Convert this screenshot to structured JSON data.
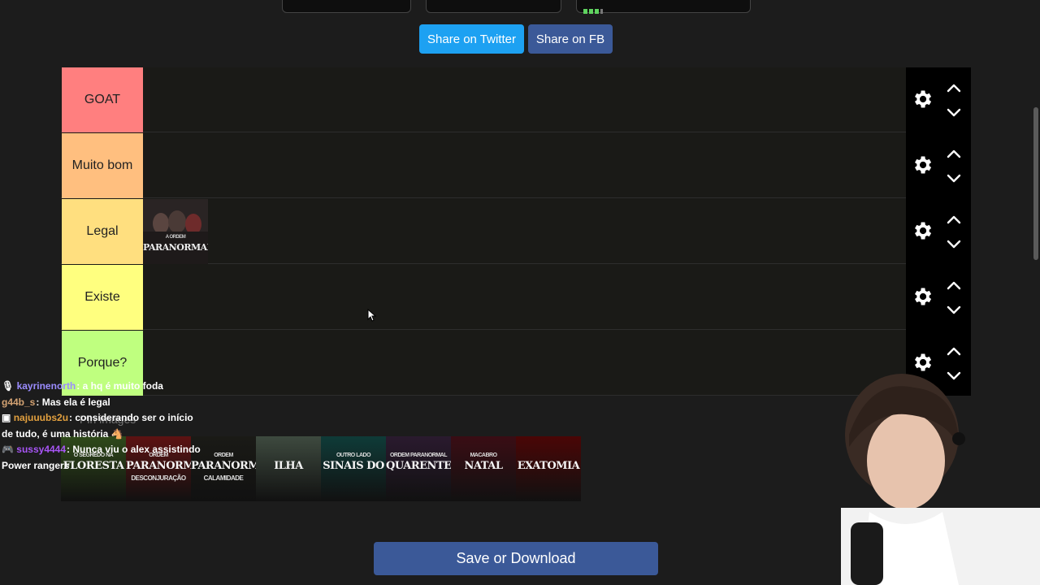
{
  "share": {
    "twitter_label": "Share on Twitter",
    "fb_label": "Share on FB",
    "twitter_color": "#1da1f2",
    "fb_color": "#3b5998"
  },
  "tiers": [
    {
      "label": "GOAT",
      "color": "#ff7f7f"
    },
    {
      "label": "Muito bom",
      "color": "#ffbf7f"
    },
    {
      "label": "Legal",
      "color": "#ffdf7f"
    },
    {
      "label": "Existe",
      "color": "#ffff7f"
    },
    {
      "label": "Porque?",
      "color": "#bfff7f"
    }
  ],
  "tier_items": {
    "legal": [
      {
        "name": "A Ordem Paranormal",
        "title": "PARANORMAL",
        "subtitle": "A ORDEM"
      }
    ]
  },
  "controls": {
    "settings_icon": "gear-icon",
    "up_icon": "chevron-up-icon",
    "down_icon": "chevron-down-icon"
  },
  "pool": {
    "label": "Pin images",
    "items": [
      {
        "title": "FLORESTA",
        "subtitle": "O SEGREDO NA",
        "color": "#2f4a1a"
      },
      {
        "title": "PARANORMAL",
        "subtitle": "ORDEM",
        "extra": "DESCONJURAÇÃO",
        "color": "#5c1212"
      },
      {
        "title": "PARANORMAL",
        "subtitle": "ORDEM",
        "extra": "CALAMIDADE",
        "color": "#1a1a16"
      },
      {
        "title": "ILHA",
        "subtitle": "",
        "color": "#3e4a3f"
      },
      {
        "title": "SINAIS DO",
        "subtitle": "OUTRO LADO",
        "color": "#0f3b38"
      },
      {
        "title": "QUARENTENA",
        "subtitle": "ORDEM PARANORMAL",
        "color": "#2a1a2e"
      },
      {
        "title": "NATAL",
        "subtitle": "MACABRO",
        "color": "#3a0d14"
      },
      {
        "title": "EXATOMIA",
        "subtitle": "",
        "color": "#4a0606"
      }
    ]
  },
  "chat": [
    {
      "user": "kayrinenorth",
      "color": "#9b8cff",
      "message": "a hq é muito foda"
    },
    {
      "user": "g44b_s",
      "color": "#d4a373",
      "message": "Mas ela é legal"
    },
    {
      "user": "najuuubs2u",
      "color": "#e2a03f",
      "message": "considerando ser o início de tudo, é uma história 🐴"
    },
    {
      "user": "sussy4444",
      "color": "#a855f7",
      "message": "Nunca viu o alex assistindo Power rangers"
    }
  ],
  "save_label": "Save or Download"
}
